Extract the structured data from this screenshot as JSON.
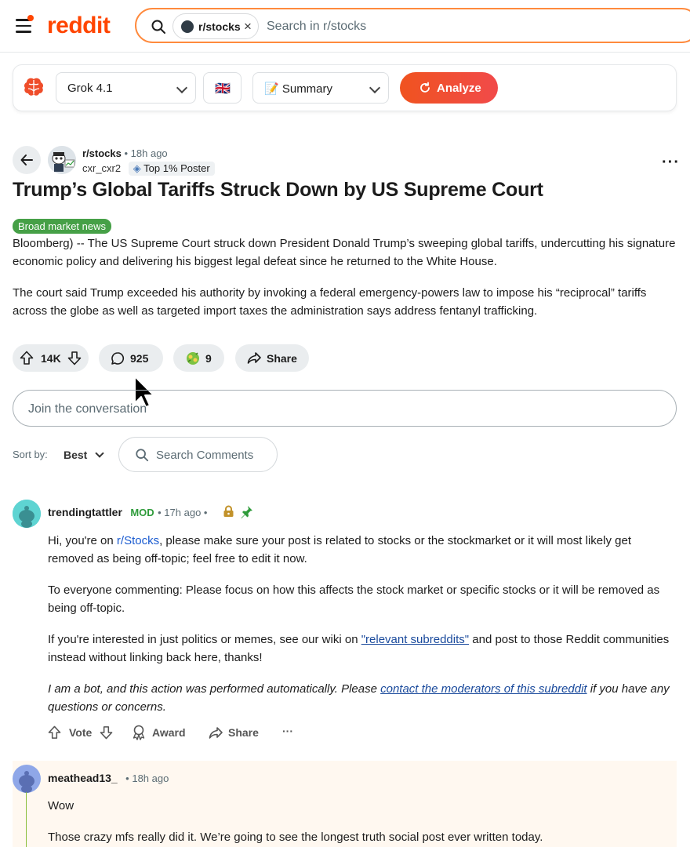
{
  "header": {
    "logo": "reddit",
    "search_chip": "r/stocks",
    "search_chip_close": "×",
    "search_placeholder": "Search in r/stocks"
  },
  "toolbar": {
    "model": "Grok 4.1",
    "language_flag": "🇬🇧",
    "mode": "📝 Summary",
    "analyze_label": "Analyze"
  },
  "post": {
    "subreddit": "r/stocks",
    "time": "• 18h ago",
    "author": "cxr_cxr2",
    "author_badge": "Top 1% Poster",
    "title": "Trump’s Global Tariffs Struck Down by US Supreme Court",
    "flair": "Broad market news",
    "paragraphs": [
      "Bloomberg) -- The US Supreme Court struck down President Donald Trump’s sweeping global tariffs, undercutting his signature economic policy and delivering his biggest legal defeat since he returned to the White House.",
      "The court said Trump exceeded his authority by invoking a federal emergency-powers law to impose his “reciprocal” tariffs across the globe as well as targeted import taxes the administration says address fentanyl trafficking."
    ],
    "votes": "14K",
    "comments": "925",
    "awards": "9",
    "share_label": "Share"
  },
  "composer": {
    "placeholder": "Join the conversation"
  },
  "sort": {
    "label": "Sort by:",
    "value": "Best",
    "search_placeholder": "Search Comments"
  },
  "comments": [
    {
      "user": "trendingtattler",
      "role": "MOD",
      "time": "• 17h ago •",
      "p1_pre": "Hi, you're on ",
      "p1_link": "r/Stocks",
      "p1_post": ", please make sure your post is related to stocks or the stockmarket or it will most likely get removed as being off-topic; feel free to edit it now.",
      "p2": "To everyone commenting: Please focus on how this affects the stock market or specific stocks or it will be removed as being off-topic.",
      "p3_pre": "If you're interested in just politics or memes, see our wiki on ",
      "p3_link": "\"relevant subreddits\"",
      "p3_post": " and post to those Reddit communities instead without linking back here, thanks!",
      "p4_pre": "I am a bot, and this action was performed automatically. Please ",
      "p4_link": "contact the moderators of this subreddit",
      "p4_post": " if you have any questions or concerns.",
      "vote_label": "Vote",
      "award_label": "Award",
      "share_label": "Share",
      "more": "···"
    },
    {
      "user": "meathead13_",
      "time": "• 18h ago",
      "p1": "Wow",
      "p2": "Those crazy mfs really did it. We’re going to see the longest truth social post ever written today."
    }
  ],
  "colors": {
    "brand": "#ff4500",
    "analyze": "#f0531f",
    "flair": "#46a047",
    "mod": "#2e9b3a",
    "link": "#1a4a9c"
  }
}
